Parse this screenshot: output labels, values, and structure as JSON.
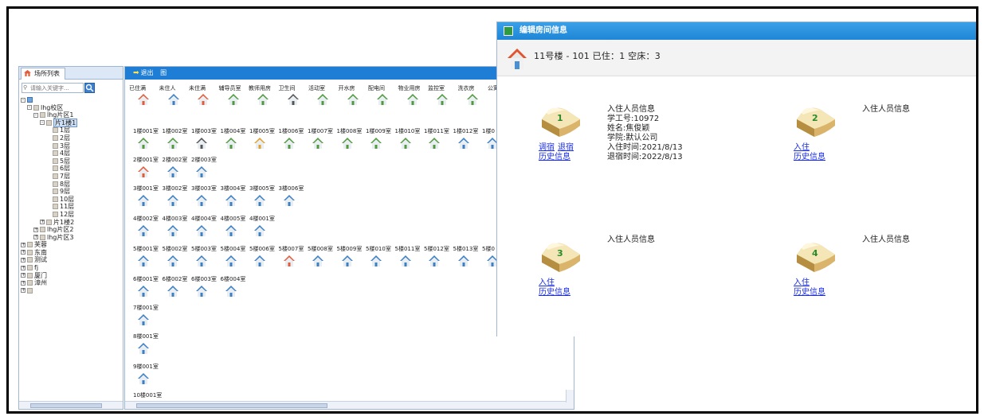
{
  "tree": {
    "tab_label": "场所列表",
    "search_placeholder": "请输入关键字...",
    "nodes": [
      {
        "label": "",
        "level": 0,
        "toggle": "-",
        "icon": "root"
      },
      {
        "label": "lhg校区",
        "level": 1,
        "toggle": "-"
      },
      {
        "label": "lhg片区1",
        "level": 2,
        "toggle": "-"
      },
      {
        "label": "片1楼1",
        "level": 3,
        "toggle": "-",
        "selected": true
      },
      {
        "label": "1层",
        "level": 4
      },
      {
        "label": "2层",
        "level": 4
      },
      {
        "label": "3层",
        "level": 4
      },
      {
        "label": "4层",
        "level": 4
      },
      {
        "label": "5层",
        "level": 4
      },
      {
        "label": "6层",
        "level": 4
      },
      {
        "label": "7层",
        "level": 4
      },
      {
        "label": "8层",
        "level": 4
      },
      {
        "label": "9层",
        "level": 4
      },
      {
        "label": "10层",
        "level": 4
      },
      {
        "label": "11层",
        "level": 4
      },
      {
        "label": "12层",
        "level": 4
      },
      {
        "label": "片1楼2",
        "level": 3,
        "toggle": "+"
      },
      {
        "label": "lhg片区2",
        "level": 2,
        "toggle": "+"
      },
      {
        "label": "lhg片区3",
        "level": 2,
        "toggle": "+"
      },
      {
        "label": "芙蓉",
        "level": 0,
        "toggle": "+"
      },
      {
        "label": "东南",
        "level": 0,
        "toggle": "+"
      },
      {
        "label": "测试",
        "level": 0,
        "toggle": "+"
      },
      {
        "label": "fj",
        "level": 0,
        "toggle": "+"
      },
      {
        "label": "厦门",
        "level": 0,
        "toggle": "+"
      },
      {
        "label": "漳州",
        "level": 0,
        "toggle": "+"
      },
      {
        "label": "",
        "level": 0,
        "toggle": "+"
      }
    ]
  },
  "toolbar": {
    "exit_label": "退出",
    "extra_label": "图"
  },
  "legend": [
    {
      "label": "已住满",
      "color": "#e15c3a"
    },
    {
      "label": "未住人",
      "color": "#3b7fc4"
    },
    {
      "label": "未住满",
      "color": "#e15c3a"
    },
    {
      "label": "辅导员室",
      "color": "#4f9a3c"
    },
    {
      "label": "教师用房",
      "color": "#4f9a3c"
    },
    {
      "label": "卫生间",
      "color": "#555555"
    },
    {
      "label": "活动室",
      "color": "#4f9a3c"
    },
    {
      "label": "开水房",
      "color": "#4f9a3c"
    },
    {
      "label": "配电间",
      "color": "#4f9a3c"
    },
    {
      "label": "物业用房",
      "color": "#4f9a3c"
    },
    {
      "label": "监控室",
      "color": "#4f9a3c"
    },
    {
      "label": "洗衣房",
      "color": "#4f9a3c"
    },
    {
      "label": "公寓办",
      "color": "#4f9a3c"
    }
  ],
  "floors": [
    {
      "rooms": [
        "1楼001室",
        "1楼002室",
        "1楼003室",
        "1楼004室",
        "1楼005室",
        "1楼006室",
        "1楼007室",
        "1楼008室",
        "1楼009室",
        "1楼010室",
        "1楼011室",
        "1楼012室",
        "1楼0"
      ],
      "colors": [
        "#4f9a3c",
        "#4f9a3c",
        "#555555",
        "#4f9a3c",
        "#e0a030",
        "#4f9a3c",
        "#4f9a3c",
        "#4f9a3c",
        "#4f9a3c",
        "#4f9a3c",
        "#4f9a3c",
        "#3b7fc4",
        "#3b7fc4"
      ]
    },
    {
      "rooms": [
        "2楼001室",
        "2楼002室",
        "2楼003室"
      ],
      "colors": [
        "#e15c3a",
        "#3b7fc4",
        "#3b7fc4"
      ]
    },
    {
      "rooms": [
        "3楼001室",
        "3楼002室",
        "3楼003室",
        "3楼004室",
        "3楼005室",
        "3楼006室"
      ],
      "colors": [
        "#3b7fc4",
        "#3b7fc4",
        "#3b7fc4",
        "#3b7fc4",
        "#3b7fc4",
        "#3b7fc4"
      ]
    },
    {
      "rooms": [
        "4楼002室",
        "4楼003室",
        "4楼004室",
        "4楼005室",
        "4楼001室"
      ],
      "colors": [
        "#3b7fc4",
        "#3b7fc4",
        "#3b7fc4",
        "#3b7fc4",
        "#3b7fc4"
      ]
    },
    {
      "rooms": [
        "5楼001室",
        "5楼002室",
        "5楼003室",
        "5楼004室",
        "5楼006室",
        "5楼007室",
        "5楼008室",
        "5楼009室",
        "5楼010室",
        "5楼011室",
        "5楼012室",
        "5楼013室",
        "5楼0"
      ],
      "colors": [
        "#3b7fc4",
        "#3b7fc4",
        "#3b7fc4",
        "#3b7fc4",
        "#3b7fc4",
        "#e15c3a",
        "#3b7fc4",
        "#3b7fc4",
        "#3b7fc4",
        "#3b7fc4",
        "#3b7fc4",
        "#3b7fc4",
        "#3b7fc4"
      ]
    },
    {
      "rooms": [
        "6楼001室",
        "6楼002室",
        "6楼003室",
        "6楼004室"
      ],
      "colors": [
        "#3b7fc4",
        "#3b7fc4",
        "#3b7fc4",
        "#3b7fc4"
      ]
    },
    {
      "rooms": [
        "7楼001室"
      ],
      "colors": [
        "#3b7fc4"
      ]
    },
    {
      "rooms": [
        "8楼001室"
      ],
      "colors": [
        "#3b7fc4"
      ]
    },
    {
      "rooms": [
        "9楼001室"
      ],
      "colors": [
        "#3b7fc4"
      ]
    },
    {
      "rooms": [
        "10楼001室"
      ],
      "colors": [
        "#3b7fc4"
      ]
    }
  ],
  "dialog": {
    "title": "编辑房间信息",
    "room_summary": "11号楼 - 101   已住：1  空床：3",
    "beds": [
      {
        "number": "1",
        "links": [
          [
            "调宿",
            "退宿"
          ],
          [
            "历史信息"
          ]
        ],
        "occupant_header": "入住人员信息",
        "occupant_lines": [
          "学工号:10972",
          "姓名:焦俊颖",
          "学院:默认公司",
          "入住时间:2021/8/13",
          "退宿时间:2022/8/13"
        ]
      },
      {
        "number": "2",
        "links": [
          [
            "入住"
          ],
          [
            "历史信息"
          ]
        ],
        "occupant_header": "入住人员信息",
        "occupant_lines": []
      },
      {
        "number": "3",
        "links": [
          [
            "入住"
          ],
          [
            "历史信息"
          ]
        ],
        "occupant_header": "入住人员信息",
        "occupant_lines": []
      },
      {
        "number": "4",
        "links": [
          [
            "入住"
          ],
          [
            "历史信息"
          ]
        ],
        "occupant_header": "入住人员信息",
        "occupant_lines": []
      }
    ]
  }
}
